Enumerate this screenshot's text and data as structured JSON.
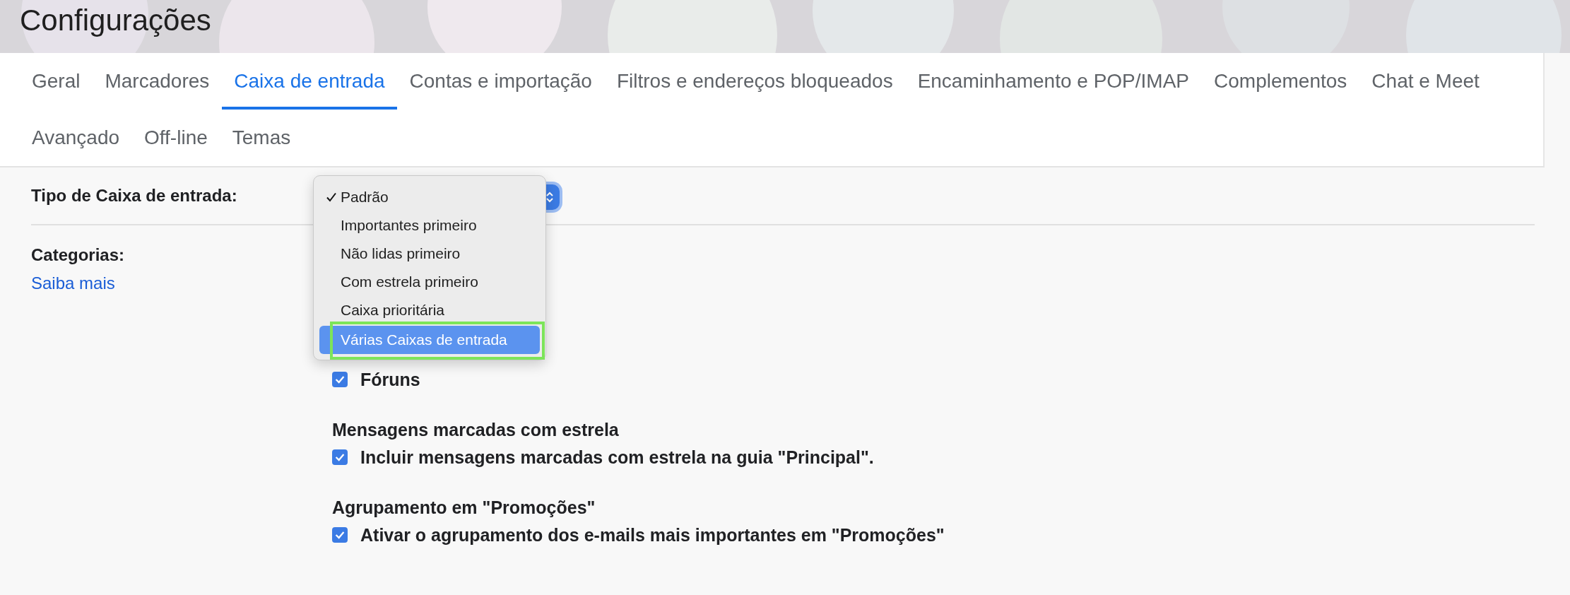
{
  "page_title": "Configurações",
  "tabs": [
    {
      "label": "Geral",
      "selected": false
    },
    {
      "label": "Marcadores",
      "selected": false
    },
    {
      "label": "Caixa de entrada",
      "selected": true
    },
    {
      "label": "Contas e importação",
      "selected": false
    },
    {
      "label": "Filtros e endereços bloqueados",
      "selected": false
    },
    {
      "label": "Encaminhamento e POP/IMAP",
      "selected": false
    },
    {
      "label": "Complementos",
      "selected": false
    },
    {
      "label": "Chat e Meet",
      "selected": false
    },
    {
      "label": "Avançado",
      "selected": false
    },
    {
      "label": "Off-line",
      "selected": false
    },
    {
      "label": "Temas",
      "selected": false
    }
  ],
  "inbox_type": {
    "label": "Tipo de Caixa de entrada:",
    "menu": [
      {
        "label": "Padrão",
        "checked": true,
        "hovered": false,
        "outlined": false
      },
      {
        "label": "Importantes primeiro",
        "checked": false,
        "hovered": false,
        "outlined": false
      },
      {
        "label": "Não lidas primeiro",
        "checked": false,
        "hovered": false,
        "outlined": false
      },
      {
        "label": "Com estrela primeiro",
        "checked": false,
        "hovered": false,
        "outlined": false
      },
      {
        "label": "Caixa prioritária",
        "checked": false,
        "hovered": false,
        "outlined": false
      },
      {
        "label": "Várias Caixas de entrada",
        "checked": false,
        "hovered": true,
        "outlined": true
      }
    ]
  },
  "categories": {
    "label": "Categorias:",
    "link": "Saiba mais",
    "options": [
      {
        "label": "Fóruns",
        "checked": true
      }
    ]
  },
  "sections": [
    {
      "heading": "Mensagens marcadas com estrela",
      "option": {
        "label": "Incluir mensagens marcadas com estrela na guia \"Principal\".",
        "checked": true
      }
    },
    {
      "heading": "Agrupamento em \"Promoções\"",
      "option": {
        "label": "Ativar o agrupamento dos e-mails mais importantes em \"Promoções\"",
        "checked": true
      }
    }
  ]
}
